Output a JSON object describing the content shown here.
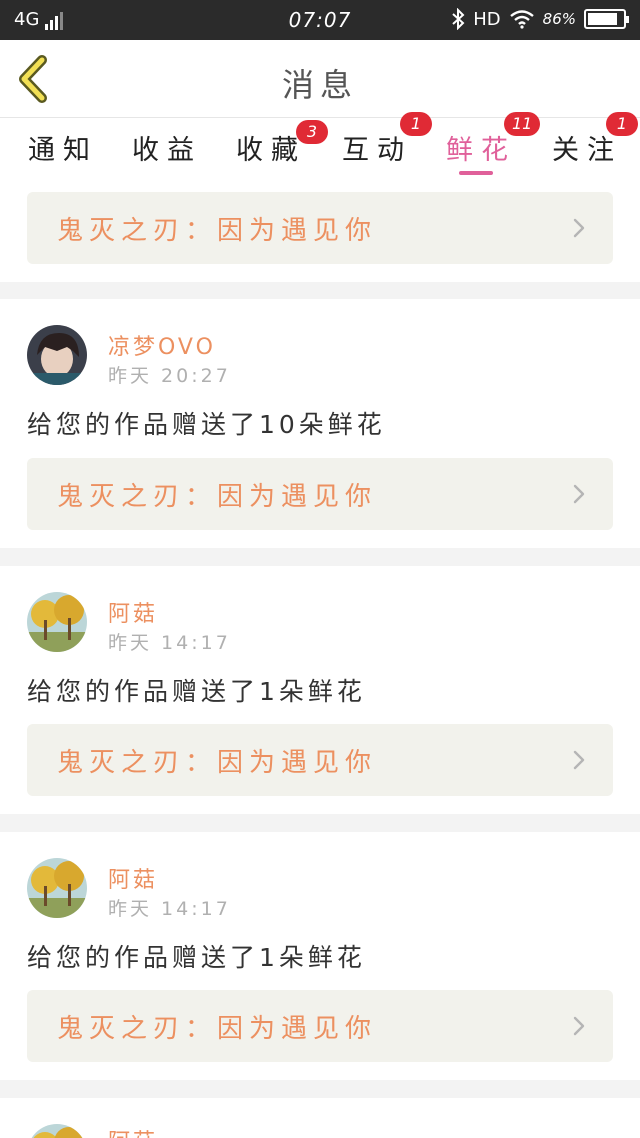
{
  "status_bar": {
    "network": "4G",
    "time": "07:07",
    "hd": "HD",
    "battery_text": "86%",
    "battery_level": 0.86
  },
  "header": {
    "title": "消息",
    "back_icon": "chevron-left-icon"
  },
  "tabs": [
    {
      "label": "通知",
      "badge": null,
      "active": false
    },
    {
      "label": "收益",
      "badge": null,
      "active": false
    },
    {
      "label": "收藏",
      "badge": "3",
      "active": false
    },
    {
      "label": "互动",
      "badge": "1",
      "active": false
    },
    {
      "label": "鲜花",
      "badge": "11",
      "active": true
    },
    {
      "label": "关注",
      "badge": "1",
      "active": false
    }
  ],
  "colors": {
    "accent": "#e0609a",
    "badge": "#e02a35",
    "work_text": "#ec9060",
    "status_bar": "#2b2b2b"
  },
  "top_work_link": {
    "title": "鬼灭之刃：因为遇见你"
  },
  "messages": [
    {
      "user": "凉梦OVO",
      "time": "昨天 20:27",
      "text": "给您的作品赠送了10朵鲜花",
      "work": "鬼灭之刃：因为遇见你"
    },
    {
      "user": "阿菇",
      "time": "昨天 14:17",
      "text": "给您的作品赠送了1朵鲜花",
      "work": "鬼灭之刃：因为遇见你"
    },
    {
      "user": "阿菇",
      "time": "昨天 14:17",
      "text": "给您的作品赠送了1朵鲜花",
      "work": "鬼灭之刃：因为遇见你"
    },
    {
      "user": "阿菇"
    }
  ]
}
